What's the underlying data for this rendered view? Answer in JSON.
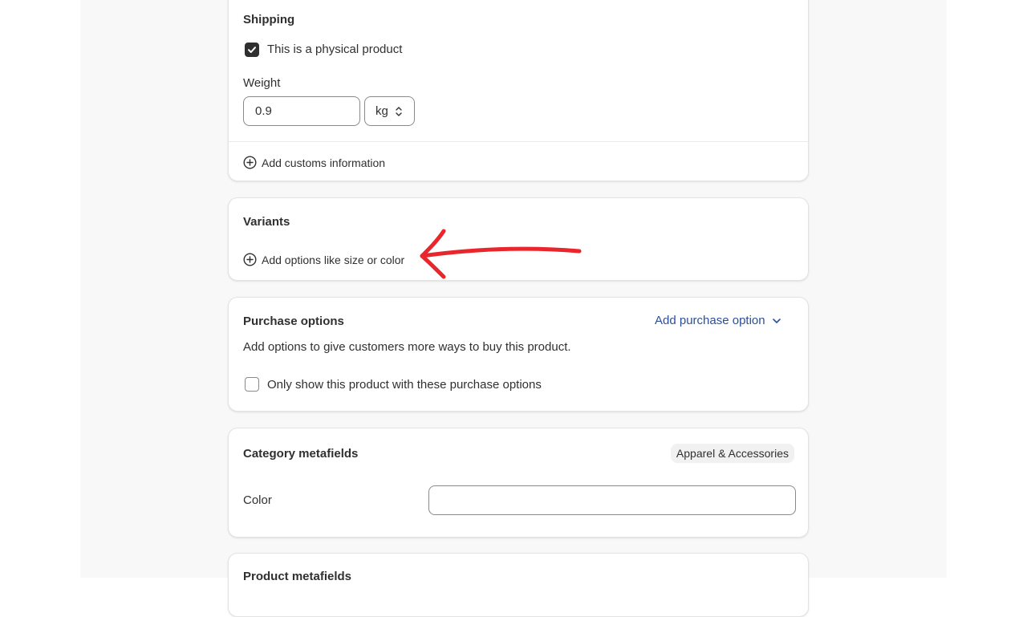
{
  "shipping": {
    "title": "Shipping",
    "physical_product_label": "This is a physical product",
    "physical_product_checked": true,
    "weight_label": "Weight",
    "weight_value": "0.9",
    "weight_unit": "kg",
    "customs_action": "Add customs information"
  },
  "variants": {
    "title": "Variants",
    "add_options_action": "Add options like size or color"
  },
  "purchase_options": {
    "title": "Purchase options",
    "add_action": "Add purchase option",
    "description": "Add options to give customers more ways to buy this product.",
    "only_show_label": "Only show this product with these purchase options",
    "only_show_checked": false
  },
  "category_metafields": {
    "title": "Category metafields",
    "category_badge": "Apparel & Accessories",
    "color_label": "Color",
    "color_value": ""
  },
  "product_metafields": {
    "title": "Product metafields"
  },
  "colors": {
    "link": "#2a4f9c",
    "annotation_arrow": "#e8262b",
    "checkbox_fill": "#303030"
  }
}
